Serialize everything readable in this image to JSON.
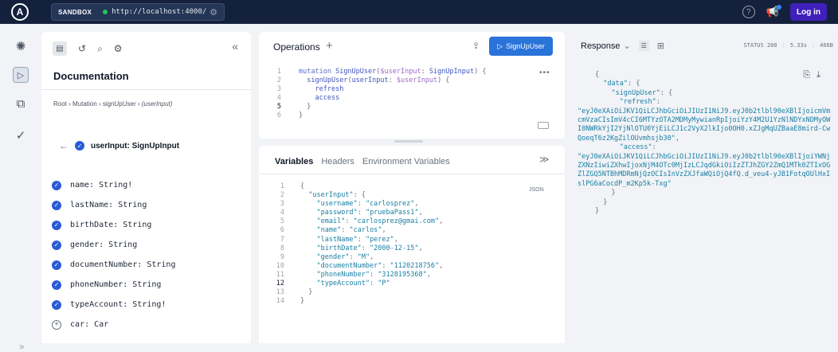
{
  "topbar": {
    "logo": "A",
    "sandbox_label": "SANDBOX",
    "endpoint_url": "http://localhost:4000/",
    "login_label": "Log in",
    "status_color": "#22c55e"
  },
  "docs": {
    "title": "Documentation",
    "breadcrumb": {
      "root": "Root",
      "mutation": "Mutation",
      "field": "signUpUser",
      "arg": "(userInput)"
    },
    "type_heading": {
      "name": "userInput",
      "type": "SignUpInput"
    },
    "fields": [
      {
        "name": "name",
        "type": "String!"
      },
      {
        "name": "lastName",
        "type": "String"
      },
      {
        "name": "birthDate",
        "type": "String"
      },
      {
        "name": "gender",
        "type": "String"
      },
      {
        "name": "documentNumber",
        "type": "String"
      },
      {
        "name": "phoneNumber",
        "type": "String"
      },
      {
        "name": "typeAccount",
        "type": "String!"
      },
      {
        "name": "car",
        "type": "Car"
      }
    ]
  },
  "operations": {
    "title": "Operations",
    "run_label": "SignUpUser",
    "line_numbers": [
      "1",
      "2",
      "3",
      "4",
      "5",
      "6"
    ],
    "current_line": "5"
  },
  "variables": {
    "tabs": [
      "Variables",
      "Headers",
      "Environment Variables"
    ],
    "active_tab": "Variables",
    "format_tag": "JSON",
    "line_numbers": [
      "1",
      "2",
      "3",
      "4",
      "5",
      "6",
      "7",
      "8",
      "9",
      "10",
      "11",
      "12",
      "13",
      "14"
    ],
    "current_line": "12",
    "input_key": "userInput",
    "values": [
      {
        "key": "username",
        "value": "carlosprez"
      },
      {
        "key": "password",
        "value": "pruebaPass1"
      },
      {
        "key": "email",
        "value": "carlosprez@gmai.com"
      },
      {
        "key": "name",
        "value": "carlos"
      },
      {
        "key": "lastName",
        "value": "perez"
      },
      {
        "key": "birthDate",
        "value": "2000-12-15"
      },
      {
        "key": "gender",
        "value": "M"
      },
      {
        "key": "documentNumber",
        "value": "1120218756"
      },
      {
        "key": "phoneNumber",
        "value": "3128195368"
      },
      {
        "key": "typeAccount",
        "value": "P"
      }
    ]
  },
  "response": {
    "title": "Response",
    "status_label": "STATUS",
    "status_code": "200",
    "time": "5.33s",
    "size": "466B",
    "refresh_token": "eyJ0eXAiOiJKV1QiLCJhbGciOiJIUzI1NiJ9.eyJ0b2tlbl90eXBlIjoicmVmcmVzaCIsImV4cCI6MTYzOTA2MDMyMywianRpIjoiYzY4M2U1YzNlNDYxNDMyOWI0NWRkYjI2YjNlOTU0YjEiLCJ1c2VyX2lkIjo0OH0.xZJgMqUZBaaE8mird-CwQoeqT6z2KgZilOUvmhsjb30",
    "access_token": "eyJ0eXAiOiJKV1QiLCJhbGciOiJIUzI1NiJ9.eyJ0b2tlbl90eXBlIjoiYWNjZXNzIiwiZXhwIjoxNjM4OTc0MjIzLCJqdGkiOiIzZTJhZGY2ZmQ1MTk0ZTIxOGZlZGQ5NTBhMDRmNjQzOCIsInVzZXJfaWQiOjQ4fQ.d_veu4-yJB1FotqOUlHxIslPG6aCocdP_m2Kp5k-Txg"
  }
}
